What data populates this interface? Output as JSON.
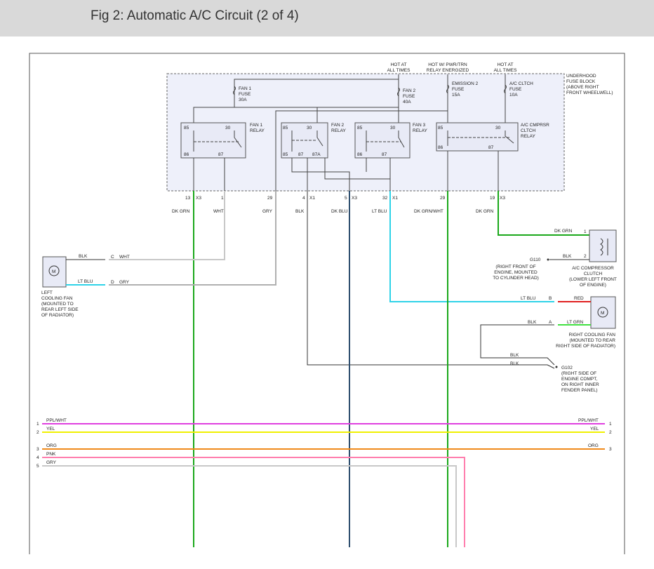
{
  "page": {
    "title": "Fig 2: Automatic A/C Circuit (2 of 4)"
  },
  "power": {
    "hot1": [
      "HOT AT",
      "ALL TIMES"
    ],
    "hot2": [
      "HOT W/ PWR/TRN",
      "RELAY ENERGIZED"
    ],
    "hot3": [
      "HOT AT",
      "ALL TIMES"
    ]
  },
  "fuse_block": [
    "UNDERHOOD",
    "FUSE BLOCK",
    "(ABOVE RIGHT",
    "FRONT WHEELWELL)"
  ],
  "fuses": {
    "fan1": [
      "FAN 1",
      "FUSE",
      "30A"
    ],
    "fan2": [
      "FAN 2",
      "FUSE",
      "40A"
    ],
    "emission2": [
      "EMISSION 2",
      "FUSE",
      "15A"
    ],
    "acclutch": [
      "A/C CLTCH",
      "FUSE",
      "10A"
    ]
  },
  "relays": {
    "fan1": [
      "FAN 1",
      "RELAY"
    ],
    "fan2": [
      "FAN 2",
      "RELAY"
    ],
    "fan3": [
      "FAN 3",
      "RELAY"
    ],
    "ac": [
      "A/C CMPRSR",
      "CLTCH",
      "RELAY"
    ]
  },
  "pins": {
    "p85": "85",
    "p30": "30",
    "p86": "86",
    "p87": "87",
    "p87a": "87A"
  },
  "connectors": {
    "n13": "13",
    "x3": "X3",
    "n1": "1",
    "n29": "29",
    "n4": "4",
    "x1": "X1",
    "n5": "5",
    "n32": "32",
    "n19": "19"
  },
  "wires": {
    "dkgrn": "DK GRN",
    "wht": "WHT",
    "gry": "GRY",
    "blk": "BLK",
    "dkblu": "DK BLU",
    "ltblu": "LT BLU",
    "dkgrnwht": "DK GRN/WHT",
    "red": "RED",
    "ltgrn": "LT GRN",
    "pplwht": "PPL/WHT",
    "yel": "YEL",
    "org": "ORG",
    "pnk": "PNK"
  },
  "left_fan": {
    "label": [
      "LEFT",
      "COOLING FAN",
      "(MOUNTED TO",
      "REAR LEFT SIDE",
      "OF RADIATOR)"
    ],
    "pin_c": "C",
    "pin_d": "D",
    "motor": "M"
  },
  "compressor": {
    "label": [
      "A/C COMPRESSOR",
      "CLUTCH",
      "(LOWER LEFT FRONT",
      "OF ENGINE)"
    ],
    "pin1": "1",
    "pin2": "2"
  },
  "ground_g110": {
    "name": "G110",
    "label": [
      "(RIGHT FRONT OF",
      "ENGINE, MOUNTED",
      "TO CYLINDER HEAD)"
    ]
  },
  "right_fan": {
    "label": [
      "RIGHT COOLING FAN",
      "(MOUNTED TO REAR",
      "RIGHT SIDE OF RADIATOR)"
    ],
    "pin_b": "B",
    "pin_a": "A",
    "motor": "M"
  },
  "ground_g102": {
    "name": "G102",
    "label": [
      "(RIGHT SIDE OF",
      "ENGINE COMPT,",
      "ON RIGHT INNER",
      "FENDER PANEL)"
    ]
  },
  "bus_numbers": [
    "1",
    "2",
    "3",
    "4",
    "5"
  ],
  "colors": {
    "dkgrn": "#1aa81a",
    "ltblu": "#2fd3e8",
    "dkblu": "#2f4f6f",
    "gry": "#b0b0b0",
    "ppl": "#e040e0",
    "yel": "#f0f000",
    "org": "#f08a1a",
    "pnk": "#ff7fae",
    "red": "#e02020",
    "ltgrn": "#40e040"
  }
}
